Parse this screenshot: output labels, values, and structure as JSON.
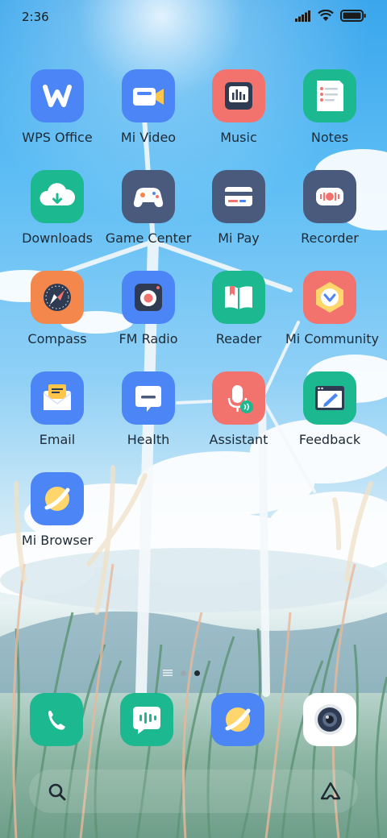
{
  "status_bar": {
    "time": "2:36",
    "icons": [
      "signal-icon",
      "wifi-icon",
      "battery-icon"
    ]
  },
  "apps": [
    {
      "label": "WPS Office",
      "icon": "wps-office-icon",
      "color": "#4c86f6"
    },
    {
      "label": "Mi Video",
      "icon": "mi-video-icon",
      "color": "#4c86f6"
    },
    {
      "label": "Music",
      "icon": "music-icon",
      "color": "#f2736e"
    },
    {
      "label": "Notes",
      "icon": "notes-icon",
      "color": "#1cb88f"
    },
    {
      "label": "Downloads",
      "icon": "downloads-icon",
      "color": "#1cb88f"
    },
    {
      "label": "Game Center",
      "icon": "game-center-icon",
      "color": "#4a5a7c"
    },
    {
      "label": "Mi Pay",
      "icon": "mi-pay-icon",
      "color": "#4a5a7c"
    },
    {
      "label": "Recorder",
      "icon": "recorder-icon",
      "color": "#4a5a7c"
    },
    {
      "label": "Compass",
      "icon": "compass-icon",
      "color": "#f4884c"
    },
    {
      "label": "FM Radio",
      "icon": "fm-radio-icon",
      "color": "#4c86f6"
    },
    {
      "label": "Reader",
      "icon": "reader-icon",
      "color": "#1cb88f"
    },
    {
      "label": "Mi Community",
      "icon": "mi-community-icon",
      "color": "#f2736e"
    },
    {
      "label": "Email",
      "icon": "email-icon",
      "color": "#4c86f6"
    },
    {
      "label": "Health",
      "icon": "health-icon",
      "color": "#4c86f6"
    },
    {
      "label": "Assistant",
      "icon": "assistant-icon",
      "color": "#f2736e"
    },
    {
      "label": "Feedback",
      "icon": "feedback-icon",
      "color": "#1cb88f"
    },
    {
      "label": "Mi Browser",
      "icon": "mi-browser-icon",
      "color": "#4c86f6"
    }
  ],
  "page_indicator": {
    "pages": 2,
    "current": 2
  },
  "dock": [
    {
      "icon": "phone-icon",
      "color": "#1cb88f"
    },
    {
      "icon": "messaging-icon",
      "color": "#1cb88f"
    },
    {
      "icon": "browser-icon",
      "color": "#4c86f6"
    },
    {
      "icon": "camera-icon",
      "color": "#ffffff"
    }
  ],
  "search_bar": {
    "left_icon": "search-icon",
    "right_icon": "assistant-a-icon"
  }
}
